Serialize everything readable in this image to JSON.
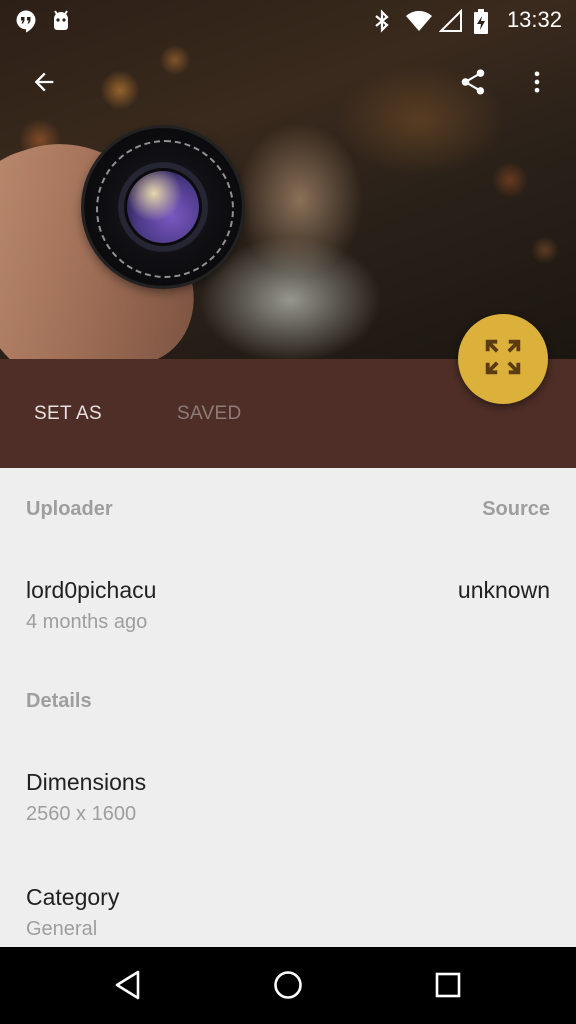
{
  "status_bar": {
    "time": "13:32",
    "left_icons": [
      "hangouts-icon",
      "android-icon"
    ],
    "right_icons": [
      "bluetooth-icon",
      "wifi-icon",
      "signal-icon",
      "battery-icon"
    ]
  },
  "toolbar": {
    "icons": [
      "arrow-back-icon",
      "share-icon",
      "more-vert-icon"
    ]
  },
  "actions": {
    "set_as": "SET AS",
    "saved": "SAVED"
  },
  "fab": {
    "icon": "fullscreen-icon",
    "color": "#dcb13b"
  },
  "uploader": {
    "label": "Uploader",
    "name": "lord0pichacu",
    "time": "4 months ago"
  },
  "source": {
    "label": "Source",
    "value": "unknown"
  },
  "details": {
    "label": "Details",
    "dimensions_label": "Dimensions",
    "dimensions_value": "2560 x 1600",
    "category_label": "Category",
    "category_value": "General"
  },
  "nav": {
    "icons": [
      "back-icon",
      "home-icon",
      "recents-icon"
    ]
  },
  "colors": {
    "action_bar": "#4e2e27",
    "accent": "#dcb13b",
    "background": "#eeeeee"
  }
}
